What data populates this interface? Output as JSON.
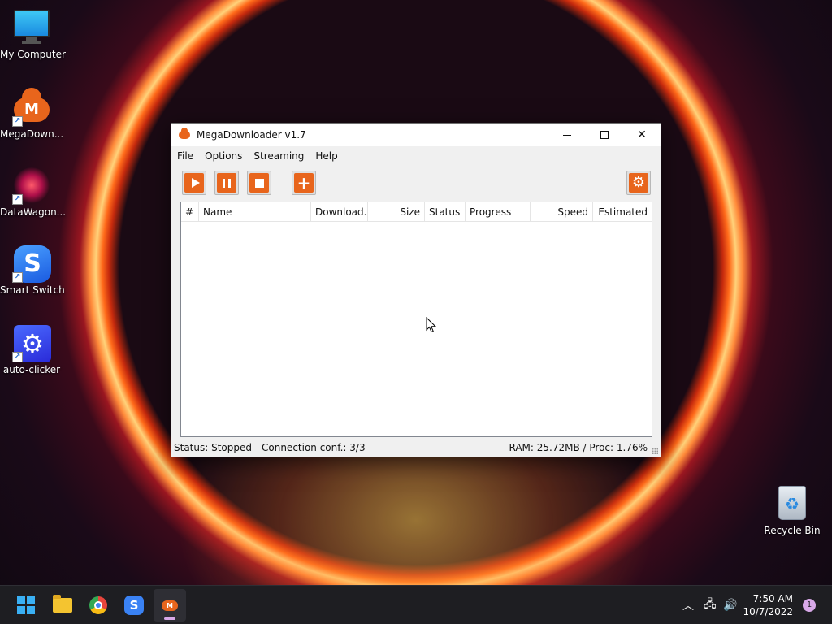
{
  "desktop": {
    "icons": [
      {
        "label": "My Computer",
        "icon": "computer-icon"
      },
      {
        "label": "MegaDown...",
        "icon": "mega-cloud-icon",
        "badge": "M"
      },
      {
        "label": "DataWagon...",
        "icon": "datawagon-icon"
      },
      {
        "label": "Smart Switch",
        "icon": "smart-switch-icon",
        "badge": "S"
      },
      {
        "label": "auto-clicker",
        "icon": "gear-icon"
      },
      {
        "label": "Recycle Bin",
        "icon": "recycle-bin-icon"
      }
    ]
  },
  "window": {
    "title": "MegaDownloader v1.7",
    "menu": [
      "File",
      "Options",
      "Streaming",
      "Help"
    ],
    "columns": [
      "#",
      "Name",
      "Download...",
      "Size",
      "Status",
      "Progress",
      "Speed",
      "Estimated"
    ],
    "status": {
      "state": "Status: Stopped",
      "connection": "Connection conf.: 3/3",
      "resources": "RAM: 25.72MB / Proc: 1.76%"
    }
  },
  "taskbar": {
    "time": "7:50 AM",
    "date": "10/7/2022",
    "notifications": "1",
    "apps": [
      "start-icon",
      "file-explorer-icon",
      "chrome-icon",
      "smart-switch-icon",
      "megadownloader-icon"
    ]
  },
  "colors": {
    "accent": "#e8651c",
    "taskbar": "#1e1e22"
  }
}
